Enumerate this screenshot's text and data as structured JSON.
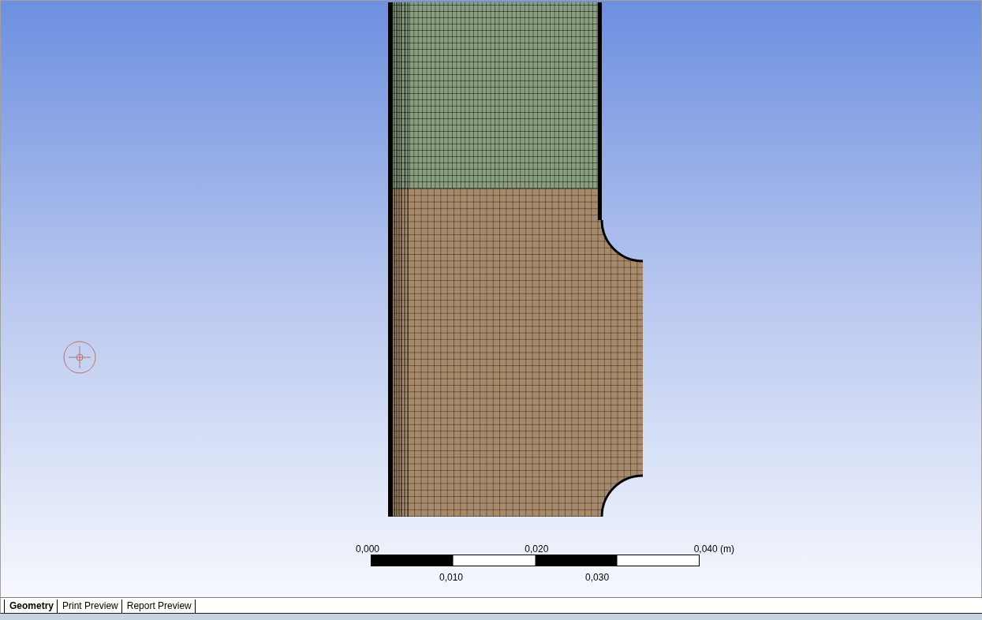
{
  "viewport": {
    "scale_bar": {
      "top_labels": [
        "0,000",
        "0,020",
        "0,040 (m)"
      ],
      "bottom_labels": [
        "0,010",
        "0,030"
      ]
    }
  },
  "tabs": [
    {
      "label": "Geometry",
      "selected": true
    },
    {
      "label": "Print Preview",
      "selected": false
    },
    {
      "label": "Report Preview",
      "selected": false
    }
  ]
}
